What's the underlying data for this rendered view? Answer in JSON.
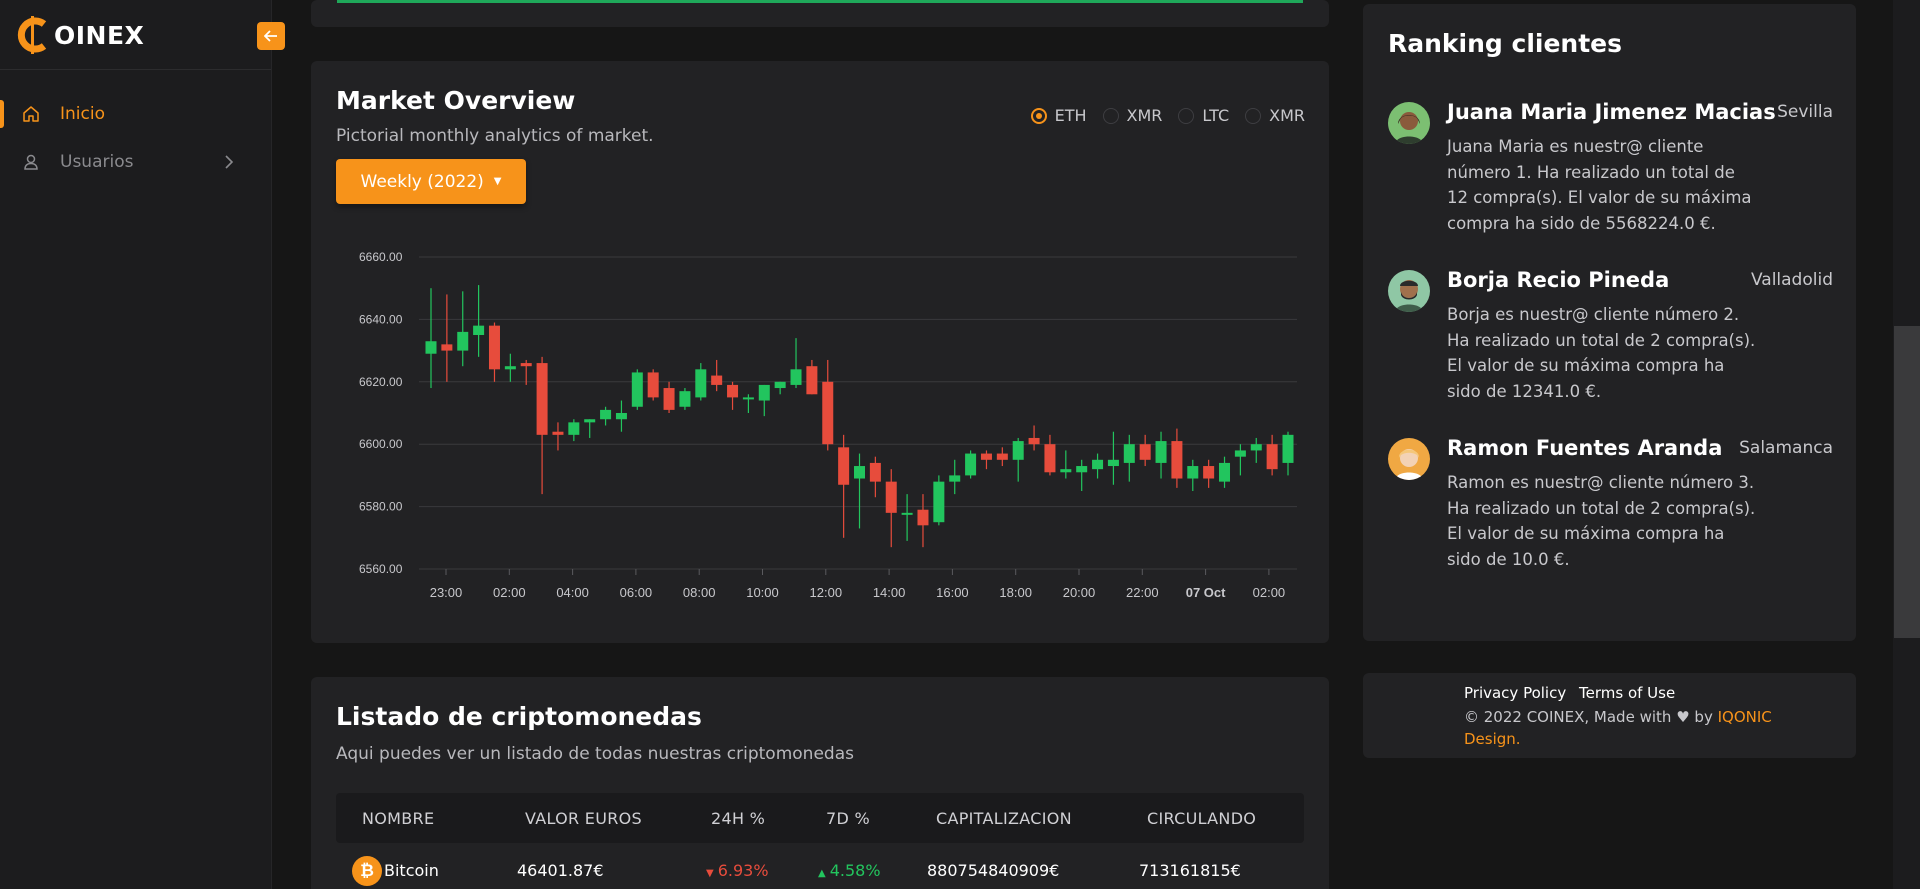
{
  "brand": {
    "name": "OINEX",
    "logo_letter": "C"
  },
  "sidebar": {
    "items": [
      {
        "label": "Inicio",
        "icon": "home-icon",
        "active": true
      },
      {
        "label": "Usuarios",
        "icon": "user-icon",
        "active": false
      }
    ]
  },
  "colors": {
    "accent": "#f7931a",
    "up": "#22c55e",
    "down": "#e74c3c",
    "card": "#222224",
    "background": "#161616"
  },
  "market": {
    "title": "Market Overview",
    "subtitle": "Pictorial monthly analytics of market.",
    "period_button": "Weekly (2022)",
    "radios": [
      {
        "label": "ETH",
        "checked": true
      },
      {
        "label": "XMR",
        "checked": false
      },
      {
        "label": "LTC",
        "checked": false
      },
      {
        "label": "XMR",
        "checked": false
      }
    ]
  },
  "chart_data": {
    "type": "candlestick",
    "title": "",
    "xlabel": "",
    "ylabel": "",
    "ylim": [
      6560,
      6660
    ],
    "y_ticks": [
      "6660.00",
      "6640.00",
      "6620.00",
      "6600.00",
      "6580.00",
      "6560.00"
    ],
    "x_ticks": [
      "23:00",
      "02:00",
      "04:00",
      "06:00",
      "08:00",
      "10:00",
      "12:00",
      "14:00",
      "16:00",
      "18:00",
      "20:00",
      "22:00",
      "07 Oct",
      "02:00"
    ],
    "grid": true,
    "candles": [
      {
        "o": 6629,
        "h": 6650,
        "l": 6618,
        "c": 6633
      },
      {
        "o": 6632,
        "h": 6648,
        "l": 6620,
        "c": 6630
      },
      {
        "o": 6630,
        "h": 6649,
        "l": 6625,
        "c": 6636
      },
      {
        "o": 6635,
        "h": 6651,
        "l": 6628,
        "c": 6638
      },
      {
        "o": 6638,
        "h": 6639,
        "l": 6620,
        "c": 6624
      },
      {
        "o": 6624,
        "h": 6629,
        "l": 6620,
        "c": 6625
      },
      {
        "o": 6626,
        "h": 6627,
        "l": 6619,
        "c": 6625
      },
      {
        "o": 6626,
        "h": 6628,
        "l": 6584,
        "c": 6603
      },
      {
        "o": 6604,
        "h": 6607,
        "l": 6598,
        "c": 6603
      },
      {
        "o": 6603,
        "h": 6608,
        "l": 6601,
        "c": 6607
      },
      {
        "o": 6607,
        "h": 6608,
        "l": 6602,
        "c": 6608
      },
      {
        "o": 6608,
        "h": 6612,
        "l": 6606,
        "c": 6611
      },
      {
        "o": 6608,
        "h": 6614,
        "l": 6604,
        "c": 6610
      },
      {
        "o": 6612,
        "h": 6624,
        "l": 6611,
        "c": 6623
      },
      {
        "o": 6623,
        "h": 6624,
        "l": 6614,
        "c": 6615
      },
      {
        "o": 6618,
        "h": 6620,
        "l": 6610,
        "c": 6611
      },
      {
        "o": 6612,
        "h": 6618,
        "l": 6611,
        "c": 6617
      },
      {
        "o": 6615,
        "h": 6626,
        "l": 6614,
        "c": 6624
      },
      {
        "o": 6622,
        "h": 6627,
        "l": 6617,
        "c": 6619
      },
      {
        "o": 6619,
        "h": 6620,
        "l": 6611,
        "c": 6615
      },
      {
        "o": 6615,
        "h": 6616,
        "l": 6610,
        "c": 6615
      },
      {
        "o": 6614,
        "h": 6619,
        "l": 6609,
        "c": 6619
      },
      {
        "o": 6618,
        "h": 6620,
        "l": 6616,
        "c": 6620
      },
      {
        "o": 6619,
        "h": 6634,
        "l": 6618,
        "c": 6624
      },
      {
        "o": 6625,
        "h": 6627,
        "l": 6616,
        "c": 6616
      },
      {
        "o": 6620,
        "h": 6627,
        "l": 6598,
        "c": 6600
      },
      {
        "o": 6599,
        "h": 6603,
        "l": 6570,
        "c": 6587
      },
      {
        "o": 6589,
        "h": 6597,
        "l": 6573,
        "c": 6593
      },
      {
        "o": 6594,
        "h": 6596,
        "l": 6583,
        "c": 6588
      },
      {
        "o": 6588,
        "h": 6592,
        "l": 6567,
        "c": 6578
      },
      {
        "o": 6578,
        "h": 6584,
        "l": 6569,
        "c": 6578
      },
      {
        "o": 6579,
        "h": 6584,
        "l": 6567,
        "c": 6574
      },
      {
        "o": 6575,
        "h": 6590,
        "l": 6574,
        "c": 6588
      },
      {
        "o": 6588,
        "h": 6595,
        "l": 6584,
        "c": 6590
      },
      {
        "o": 6590,
        "h": 6598,
        "l": 6589,
        "c": 6597
      },
      {
        "o": 6597,
        "h": 6598,
        "l": 6592,
        "c": 6595
      },
      {
        "o": 6597,
        "h": 6599,
        "l": 6593,
        "c": 6595
      },
      {
        "o": 6595,
        "h": 6602,
        "l": 6588,
        "c": 6601
      },
      {
        "o": 6602,
        "h": 6606,
        "l": 6598,
        "c": 6600
      },
      {
        "o": 6600,
        "h": 6603,
        "l": 6590,
        "c": 6591
      },
      {
        "o": 6591,
        "h": 6598,
        "l": 6589,
        "c": 6592
      },
      {
        "o": 6591,
        "h": 6595,
        "l": 6585,
        "c": 6593
      },
      {
        "o": 6592,
        "h": 6597,
        "l": 6589,
        "c": 6595
      },
      {
        "o": 6593,
        "h": 6604,
        "l": 6587,
        "c": 6595
      },
      {
        "o": 6594,
        "h": 6603,
        "l": 6588,
        "c": 6600
      },
      {
        "o": 6600,
        "h": 6603,
        "l": 6593,
        "c": 6595
      },
      {
        "o": 6594,
        "h": 6604,
        "l": 6589,
        "c": 6601
      },
      {
        "o": 6601,
        "h": 6605,
        "l": 6586,
        "c": 6589
      },
      {
        "o": 6589,
        "h": 6595,
        "l": 6585,
        "c": 6593
      },
      {
        "o": 6593,
        "h": 6595,
        "l": 6586,
        "c": 6589
      },
      {
        "o": 6588,
        "h": 6596,
        "l": 6586,
        "c": 6594
      },
      {
        "o": 6596,
        "h": 6600,
        "l": 6590,
        "c": 6598
      },
      {
        "o": 6598,
        "h": 6602,
        "l": 6594,
        "c": 6600
      },
      {
        "o": 6600,
        "h": 6603,
        "l": 6590,
        "c": 6592
      },
      {
        "o": 6594,
        "h": 6604,
        "l": 6590,
        "c": 6603
      }
    ]
  },
  "crypto": {
    "title": "Listado de criptomonedas",
    "subtitle": "Aqui puedes ver un listado de todas nuestras criptomonedas",
    "columns": [
      "NOMBRE",
      "VALOR EUROS",
      "24H %",
      "7D %",
      "CAPITALIZACION",
      "CIRCULANDO"
    ],
    "rows": [
      {
        "name": "Bitcoin",
        "icon": "bitcoin-icon",
        "value": "46401.87€",
        "change_24h": "6.93%",
        "change_7d": "4.58%",
        "cap": "880754840909€",
        "circulating": "713161815€"
      }
    ]
  },
  "ranking": {
    "title": "Ranking clientes",
    "clients": [
      {
        "name": "Juana Maria Jimenez Macias",
        "city": "Sevilla",
        "desc": "Juana Maria es nuestr@ cliente número 1. Ha realizado un total de 12 compra(s). El valor de su máxima compra ha sido de 5568224.0 €.",
        "avatar_bg": "#7cbf72"
      },
      {
        "name": "Borja Recio Pineda",
        "city": "Valladolid",
        "desc": "Borja es nuestr@ cliente número 2. Ha realizado un total de 2 compra(s). El valor de su máxima compra ha sido de 12341.0 €.",
        "avatar_bg": "#8fc7a5"
      },
      {
        "name": "Ramon Fuentes Aranda",
        "city": "Salamanca",
        "desc": "Ramon es nuestr@ cliente número 3. Ha realizado un total de 2 compra(s). El valor de su máxima compra ha sido de 10.0 €.",
        "avatar_bg": "#f0a843"
      }
    ]
  },
  "footer": {
    "privacy": "Privacy Policy",
    "terms": "Terms of Use",
    "copyright": "© 2022 COINEX, Made with",
    "by": "by",
    "author": "IQONIC Design."
  }
}
